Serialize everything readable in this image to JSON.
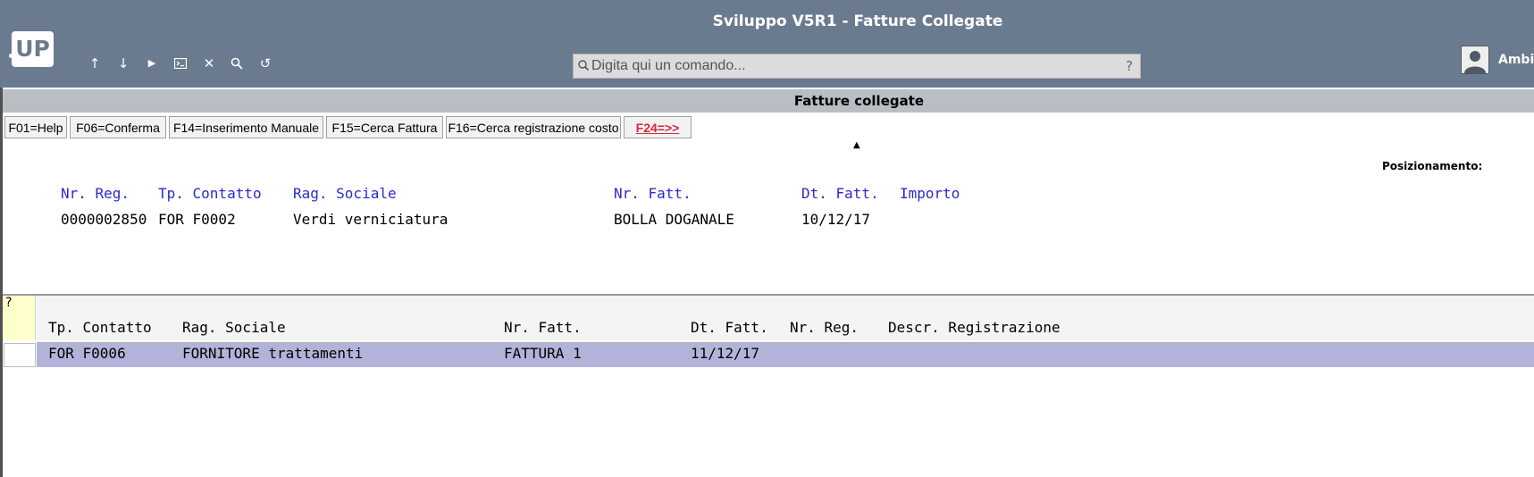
{
  "window": {
    "title": "Sviluppo V5R1 - Fatture Collegate"
  },
  "logo": {
    "text": "UP"
  },
  "toolbar": [
    {
      "name": "arrow-up-icon",
      "glyph": "↑"
    },
    {
      "name": "arrow-down-icon",
      "glyph": "↓"
    },
    {
      "name": "play-icon",
      "glyph": "▶"
    },
    {
      "name": "terminal-icon",
      "glyph": "⌨"
    },
    {
      "name": "close-icon",
      "glyph": "✕"
    },
    {
      "name": "search-icon",
      "glyph": "🔍"
    },
    {
      "name": "undo-icon",
      "glyph": "↺"
    }
  ],
  "command": {
    "placeholder": "Digita qui un comando...",
    "help": "?"
  },
  "user": {
    "name": "Ambie"
  },
  "screen": {
    "title": "Fatture collegate",
    "fkeys": [
      "F01=Help",
      "F06=Conferma",
      "F14=Inserimento Manuale",
      "F15=Cerca Fattura",
      "F16=Cerca registrazione costo",
      "F24=>>"
    ],
    "position_label": "Posizionamento:"
  },
  "header_section": {
    "labels": {
      "nr_reg": "Nr. Reg.",
      "tp_contatto": "Tp. Contatto",
      "rag_sociale": "Rag. Sociale",
      "nr_fatt": "Nr. Fatt.",
      "dt_fatt": "Dt. Fatt.",
      "importo": "Importo"
    },
    "values": {
      "nr_reg": "0000002850",
      "tp_contatto": "FOR F0002",
      "rag_sociale": "Verdi verniciatura",
      "nr_fatt": "BOLLA DOGANALE",
      "dt_fatt": "10/12/17",
      "importo": ""
    }
  },
  "subfile": {
    "help_mark": "?",
    "columns": {
      "tp_contatto": "Tp. Contatto",
      "rag_sociale": "Rag. Sociale",
      "nr_fatt": "Nr. Fatt.",
      "dt_fatt": "Dt. Fatt.",
      "nr_reg": "Nr. Reg.",
      "descr": "Descr. Registrazione"
    },
    "rows": [
      {
        "tp_contatto": "FOR F0006",
        "rag_sociale": "FORNITORE trattamenti",
        "nr_fatt": "FATTURA 1",
        "dt_fatt": "11/12/17",
        "nr_reg": "",
        "descr": ""
      }
    ]
  },
  "colors": {
    "header_bg": "#6b7b8f",
    "field_label": "#2a2ad0",
    "selected_row": "#b3b3da",
    "fkey_alert": "#d6283c"
  }
}
